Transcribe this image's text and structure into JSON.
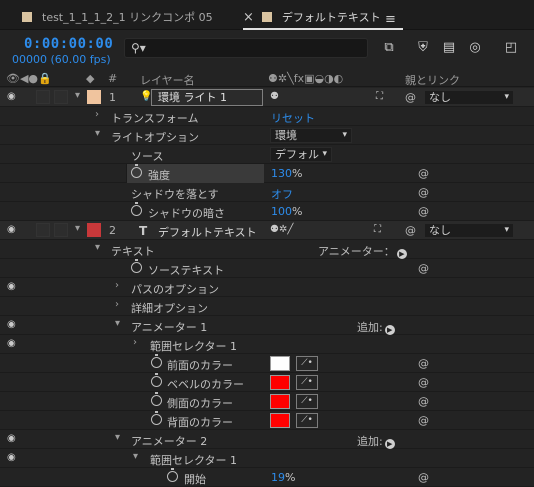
{
  "tabs": [
    {
      "label": "test_1_1_1_2_1 リンクコンポ 05",
      "active": false
    },
    {
      "label": "デフォルトテキスト",
      "active": true
    }
  ],
  "header": {
    "timecode": "0:00:00:00",
    "fps": "00000 (60.00 fps)",
    "search_placeholder": ""
  },
  "columns": {
    "num": "#",
    "layer_name": "レイヤー名",
    "parent": "親とリンク"
  },
  "layers": [
    {
      "num": "1",
      "name": "環境 ライト 1",
      "label_color": "#f0c49e",
      "parent": "なし"
    },
    {
      "num": "2",
      "name": "デフォルトテキスト",
      "label_color": "#c8383a",
      "parent": "なし"
    }
  ],
  "props": {
    "transform": "トランスフォーム",
    "reset": "リセット",
    "light_options": "ライトオプション",
    "light_options_value": "環境",
    "source": "ソース",
    "source_value": "デフォル",
    "intensity": "強度",
    "intensity_value": "130",
    "intensity_unit": "%",
    "casts_shadows": "シャドウを落とす",
    "casts_shadows_value": "オフ",
    "shadow_darkness": "シャドウの暗さ",
    "shadow_darkness_value": "100",
    "shadow_darkness_unit": "%",
    "text": "テキスト",
    "animate": "アニメーター：",
    "source_text": "ソーステキスト",
    "path_options": "パスのオプション",
    "more_options": "詳細オプション",
    "animator1": "アニメーター 1",
    "add": "追加:",
    "range_selector1": "範囲セレクター 1",
    "front_color": "前面のカラー",
    "bevel_color": "ベベルのカラー",
    "side_color": "側面のカラー",
    "back_color": "背面のカラー",
    "animator2": "アニメーター 2",
    "range_selector2": "範囲セレクター 1",
    "start": "開始",
    "start_value": "19",
    "start_unit": "%"
  },
  "colors": {
    "accent": "#2d8ceb",
    "front_color": "#ffffff",
    "bevel_color": "#ff0000",
    "side_color": "#ff0000",
    "back_color": "#ff0000"
  }
}
